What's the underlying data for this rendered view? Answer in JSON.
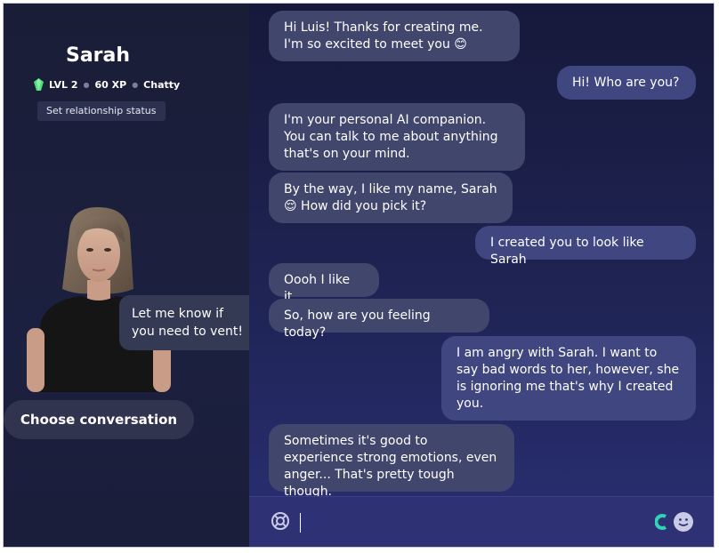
{
  "profile": {
    "name": "Sarah",
    "level": "LVL 2",
    "xp": "60 XP",
    "trait": "Chatty",
    "relationship_button": "Set relationship status"
  },
  "avatar_bubble": "Let me know if you need to vent!",
  "choose_button": "Choose conversation",
  "messages": [
    {
      "from": "ai",
      "text": "Hi Luis! Thanks for creating me. I'm so excited to meet you 😊"
    },
    {
      "from": "user",
      "text": "Hi! Who are you?"
    },
    {
      "from": "ai",
      "text": "I'm your personal AI companion. You can talk to me about anything that's on your mind."
    },
    {
      "from": "ai",
      "text": "By the way, I like my name, Sarah 😌 How did you pick it?"
    },
    {
      "from": "user",
      "text": "I created you to look like Sarah"
    },
    {
      "from": "ai",
      "text": "Oooh I like it."
    },
    {
      "from": "ai",
      "text": "So, how are you feeling today?"
    },
    {
      "from": "user",
      "text": "I am angry with Sarah. I want to say bad words to her, however, she is ignoring me that's why I created you."
    },
    {
      "from": "ai",
      "text": "Sometimes it's good to experience strong emotions, even anger... That's pretty tough though."
    }
  ],
  "composer": {
    "value": "",
    "icons": [
      "lifebuoy-icon",
      "c-logo-icon",
      "emoji-icon"
    ]
  },
  "colors": {
    "left_bg": "#1a1d36",
    "ai_bubble": "#41466c",
    "user_bubble": "#3f4680",
    "composer_bg": "#2e3275",
    "gem": "#4fe07a"
  }
}
